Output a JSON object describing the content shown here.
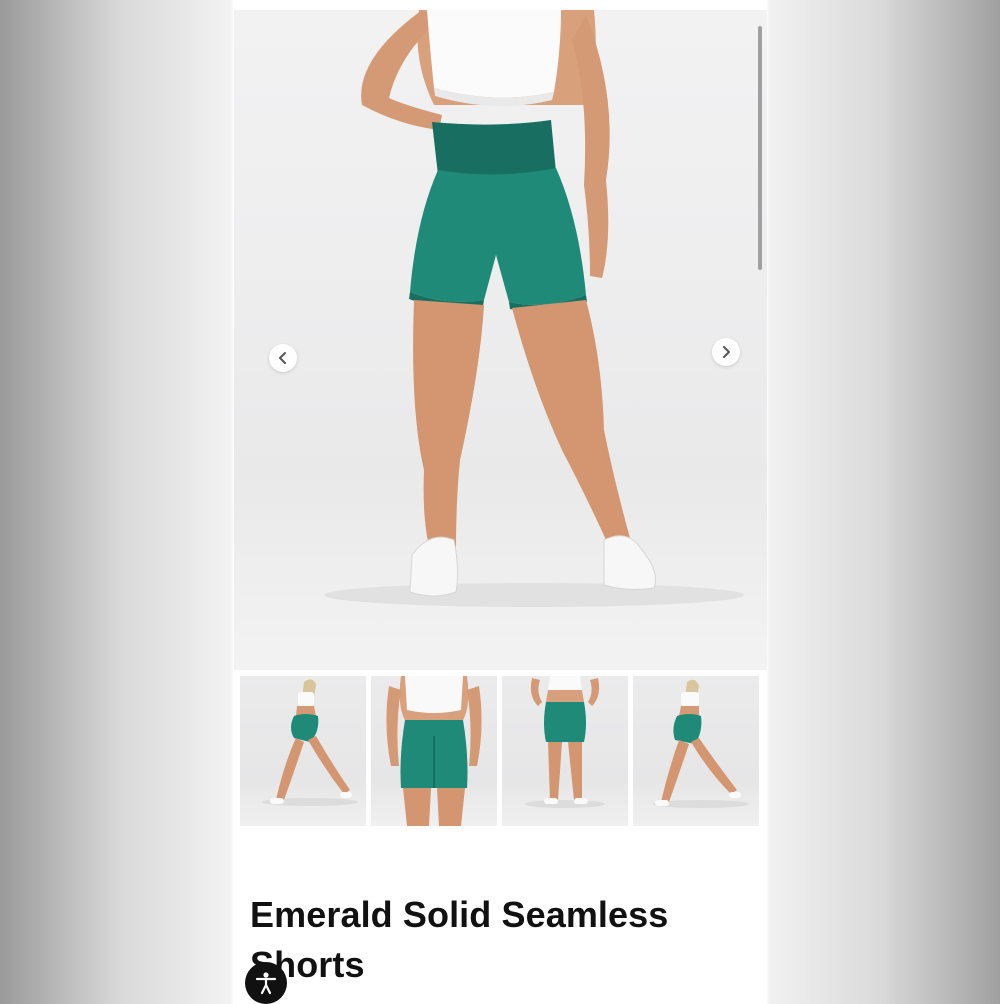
{
  "product": {
    "title": "Emerald Solid Seamless Shorts",
    "color_accent": "#1f8a78",
    "gallery": {
      "main_image": "model-front-emerald-shorts",
      "thumbnails": [
        {
          "label": "side-view"
        },
        {
          "label": "back-view"
        },
        {
          "label": "back-full-view"
        },
        {
          "label": "side-stride-view"
        }
      ]
    }
  },
  "controls": {
    "prev_icon": "chevron-left-icon",
    "next_icon": "chevron-right-icon",
    "accessibility_icon": "accessibility-icon"
  }
}
